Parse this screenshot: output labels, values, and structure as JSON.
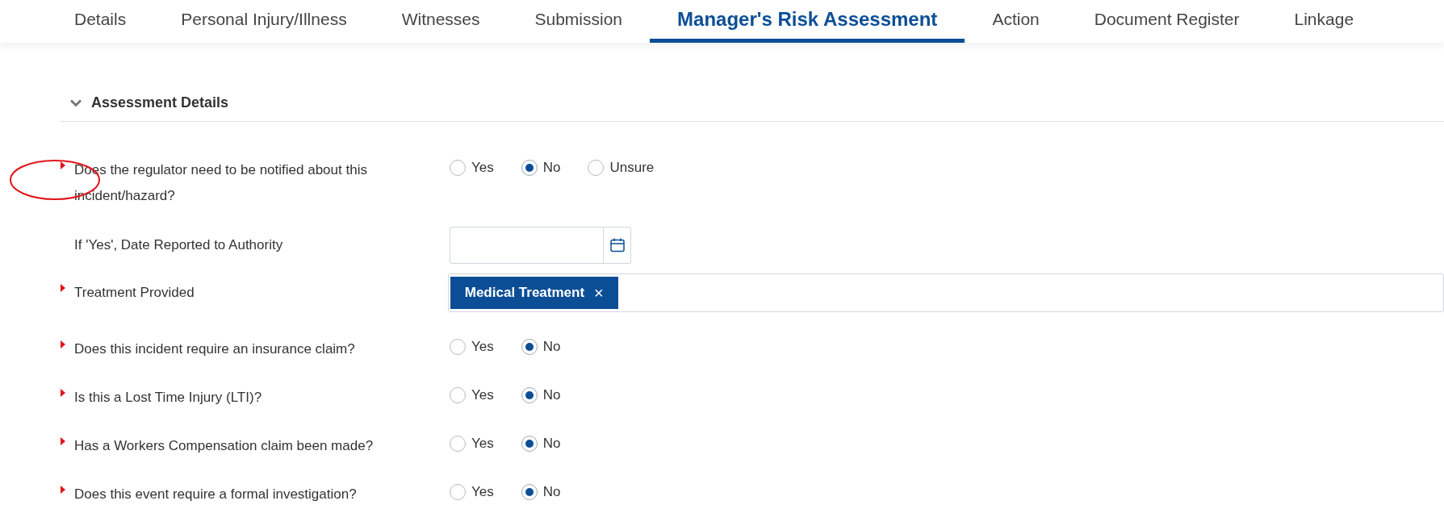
{
  "tabs": [
    {
      "label": "Details",
      "selected": false
    },
    {
      "label": "Personal Injury/Illness",
      "selected": false
    },
    {
      "label": "Witnesses",
      "selected": false
    },
    {
      "label": "Submission",
      "selected": false
    },
    {
      "label": "Manager's Risk Assessment",
      "selected": true
    },
    {
      "label": "Action",
      "selected": false
    },
    {
      "label": "Document Register",
      "selected": false
    },
    {
      "label": "Linkage",
      "selected": false
    }
  ],
  "section": {
    "title": "Assessment Details",
    "expanded": true
  },
  "fields": [
    {
      "kind": "radio",
      "required": true,
      "label": "Does the regulator need to be notified about this incident/hazard?",
      "options": [
        {
          "label": "Yes",
          "selected": false
        },
        {
          "label": "No",
          "selected": true
        },
        {
          "label": "Unsure",
          "selected": false
        }
      ]
    },
    {
      "kind": "date",
      "required": false,
      "label": "If 'Yes', Date Reported to Authority"
    },
    {
      "kind": "tags",
      "required": true,
      "label": "Treatment Provided",
      "tags": [
        {
          "label": "Medical Treatment",
          "remove": "×"
        }
      ]
    },
    {
      "kind": "radio",
      "required": true,
      "label": "Does this incident require an insurance claim?",
      "options": [
        {
          "label": "Yes",
          "selected": false
        },
        {
          "label": "No",
          "selected": true
        }
      ]
    },
    {
      "kind": "radio",
      "required": true,
      "label": "Is this a Lost Time Injury (LTI)?",
      "options": [
        {
          "label": "Yes",
          "selected": false
        },
        {
          "label": "No",
          "selected": true
        }
      ]
    },
    {
      "kind": "radio",
      "required": true,
      "label": "Has a Workers Compensation claim been made?",
      "options": [
        {
          "label": "Yes",
          "selected": false
        },
        {
          "label": "No",
          "selected": true
        }
      ]
    },
    {
      "kind": "radio",
      "required": true,
      "label": "Does this event require a formal investigation?",
      "options": [
        {
          "label": "Yes",
          "selected": false
        },
        {
          "label": "No",
          "selected": true
        }
      ]
    }
  ]
}
